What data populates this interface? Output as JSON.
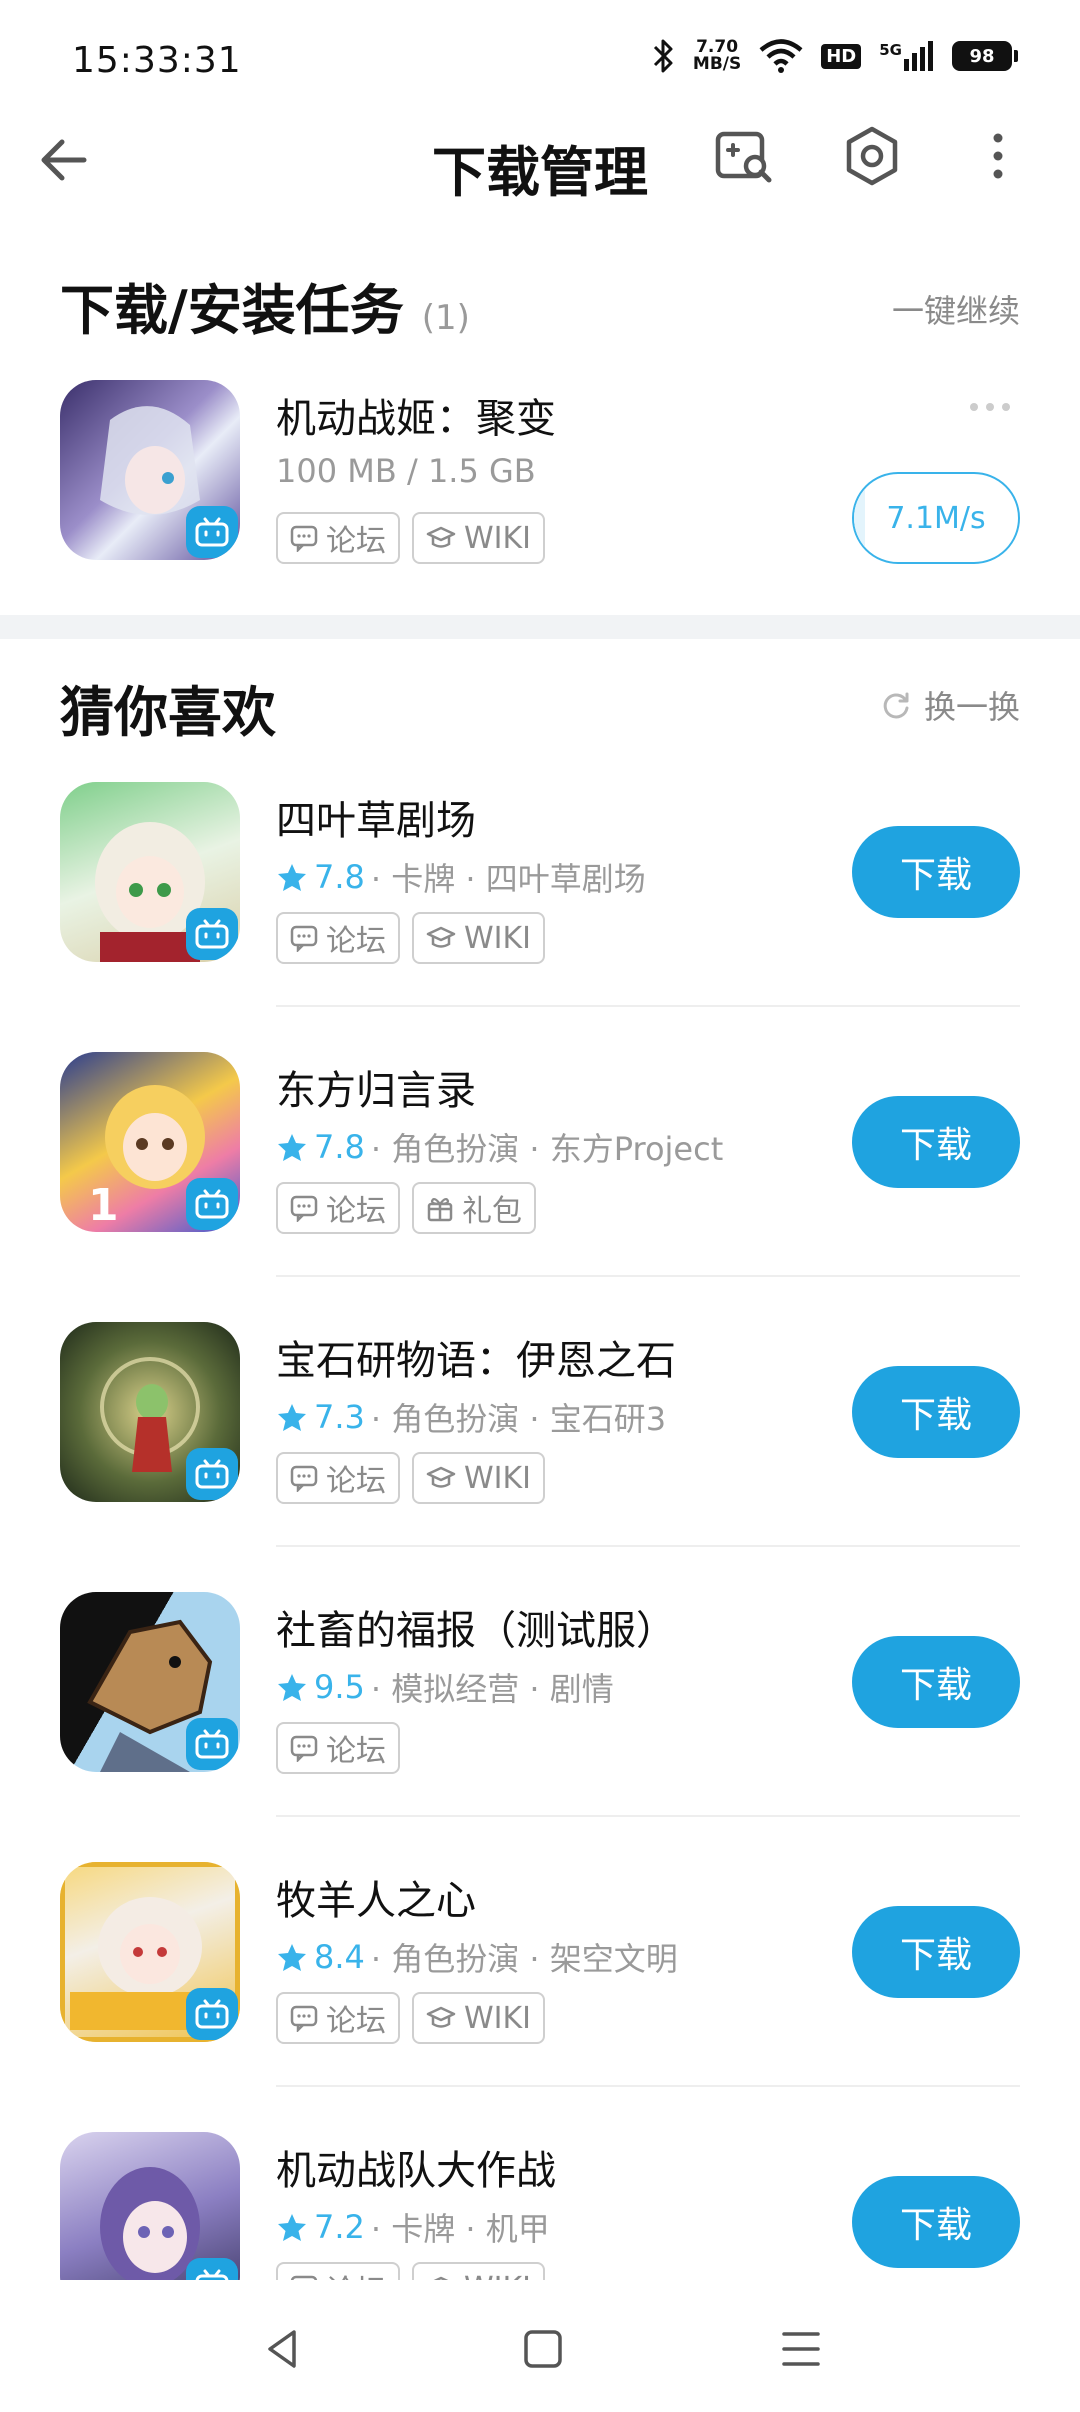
{
  "status_bar": {
    "time": "15:33:31",
    "net_speed_value": "7.70",
    "net_speed_unit": "MB/S",
    "hd": "HD",
    "network": "5G",
    "battery": "98",
    "icons": [
      "bluetooth-icon",
      "wifi-icon",
      "signal-icon",
      "battery-icon"
    ]
  },
  "header": {
    "title": "下载管理",
    "icons": [
      "back-arrow-icon",
      "game-search-icon",
      "settings-icon",
      "more-vertical-icon"
    ]
  },
  "download_section": {
    "title": "下载/安装任务",
    "count": "(1)",
    "action": "一键继续",
    "task": {
      "name": "机动战姬：聚变",
      "progress_text": "100 MB / 1.5 GB",
      "progress_fraction": 0.067,
      "speed": "7.1M/s",
      "tags": [
        {
          "label": "论坛",
          "icon": "forum-icon"
        },
        {
          "label": "WIKI",
          "icon": "wiki-icon"
        }
      ]
    }
  },
  "recommend_section": {
    "title": "猜你喜欢",
    "refresh_label": "换一换",
    "download_label": "下载",
    "apps": [
      {
        "name": "四叶草剧场",
        "rating": "7.8",
        "meta": "· 卡牌 · 四叶草剧场",
        "tags": [
          {
            "label": "论坛",
            "icon": "forum-icon"
          },
          {
            "label": "WIKI",
            "icon": "wiki-icon"
          }
        ]
      },
      {
        "name": "东方归言录",
        "rating": "7.8",
        "meta": "· 角色扮演 · 东方Project",
        "tags": [
          {
            "label": "论坛",
            "icon": "forum-icon"
          },
          {
            "label": "礼包",
            "icon": "gift-icon"
          }
        ]
      },
      {
        "name": "宝石研物语：伊恩之石",
        "rating": "7.3",
        "meta": "· 角色扮演 · 宝石研3",
        "tags": [
          {
            "label": "论坛",
            "icon": "forum-icon"
          },
          {
            "label": "WIKI",
            "icon": "wiki-icon"
          }
        ]
      },
      {
        "name": "社畜的福报（测试服）",
        "rating": "9.5",
        "meta": "· 模拟经营 · 剧情",
        "tags": [
          {
            "label": "论坛",
            "icon": "forum-icon"
          }
        ]
      },
      {
        "name": "牧羊人之心",
        "rating": "8.4",
        "meta": "· 角色扮演 · 架空文明",
        "tags": [
          {
            "label": "论坛",
            "icon": "forum-icon"
          },
          {
            "label": "WIKI",
            "icon": "wiki-icon"
          }
        ]
      },
      {
        "name": "机动战队大作战",
        "rating": "7.2",
        "meta": "· 卡牌 · 机甲",
        "tags": [
          {
            "label": "论坛",
            "icon": "forum-icon"
          },
          {
            "label": "WIKI",
            "icon": "wiki-icon"
          }
        ]
      }
    ]
  },
  "nav_bar": {
    "icons": [
      "nav-back-icon",
      "nav-home-icon",
      "nav-recents-icon"
    ]
  }
}
